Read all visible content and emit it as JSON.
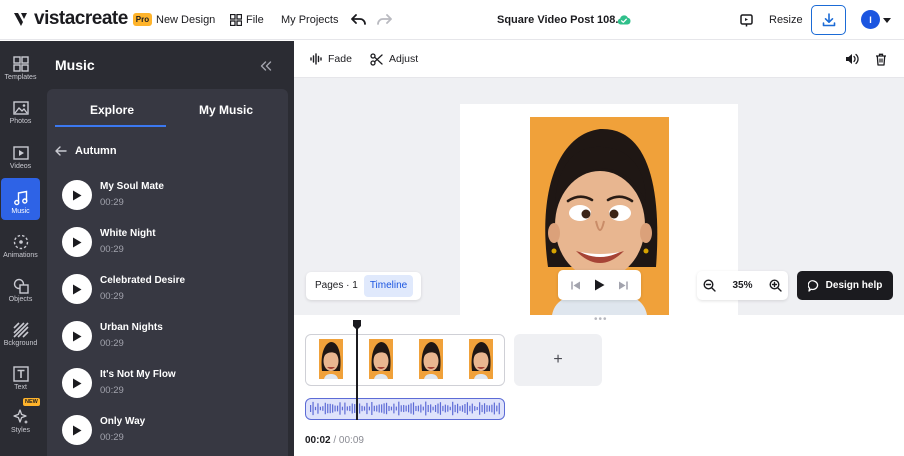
{
  "topbar": {
    "logo_text": "vistacreate",
    "pro_badge": "Pro",
    "new_design": "New Design",
    "file": "File",
    "my_projects": "My Projects",
    "doc_title": "Square Video Post 108...",
    "resize": "Resize",
    "avatar_initial": "I"
  },
  "rail": {
    "items": [
      {
        "label": "Templates",
        "icon": "templates-icon"
      },
      {
        "label": "Photos",
        "icon": "photos-icon"
      },
      {
        "label": "Videos",
        "icon": "videos-icon"
      },
      {
        "label": "Music",
        "icon": "music-icon",
        "active": true
      },
      {
        "label": "Animations",
        "icon": "animations-icon"
      },
      {
        "label": "Objects",
        "icon": "objects-icon"
      },
      {
        "label": "Bckground",
        "icon": "background-icon"
      },
      {
        "label": "Text",
        "icon": "text-icon"
      },
      {
        "label": "Styles",
        "icon": "styles-icon",
        "badge": "NEW"
      }
    ]
  },
  "panel": {
    "title": "Music",
    "tabs": [
      {
        "label": "Explore",
        "active": true
      },
      {
        "label": "My Music"
      }
    ],
    "category": "Autumn",
    "tracks": [
      {
        "name": "My Soul Mate",
        "duration": "00:29"
      },
      {
        "name": "White Night",
        "duration": "00:29"
      },
      {
        "name": "Celebrated Desire",
        "duration": "00:29"
      },
      {
        "name": "Urban Nights",
        "duration": "00:29"
      },
      {
        "name": "It's Not My Flow",
        "duration": "00:29"
      },
      {
        "name": "Only Way",
        "duration": "00:29"
      }
    ]
  },
  "toolbar": {
    "fade": "Fade",
    "adjust": "Adjust"
  },
  "canvas": {
    "pages_label": "Pages · 1",
    "timeline_label": "Timeline",
    "zoom": "35%",
    "design_help": "Design help"
  },
  "timeline": {
    "add": "+",
    "current_time": "00:02",
    "separator": "/",
    "total_time": "00:09"
  },
  "colors": {
    "accent": "#2e63e6",
    "panel_bg": "#2b2c33",
    "photo_bg": "#f0a13a",
    "audio_track": "#5c6bd6"
  }
}
